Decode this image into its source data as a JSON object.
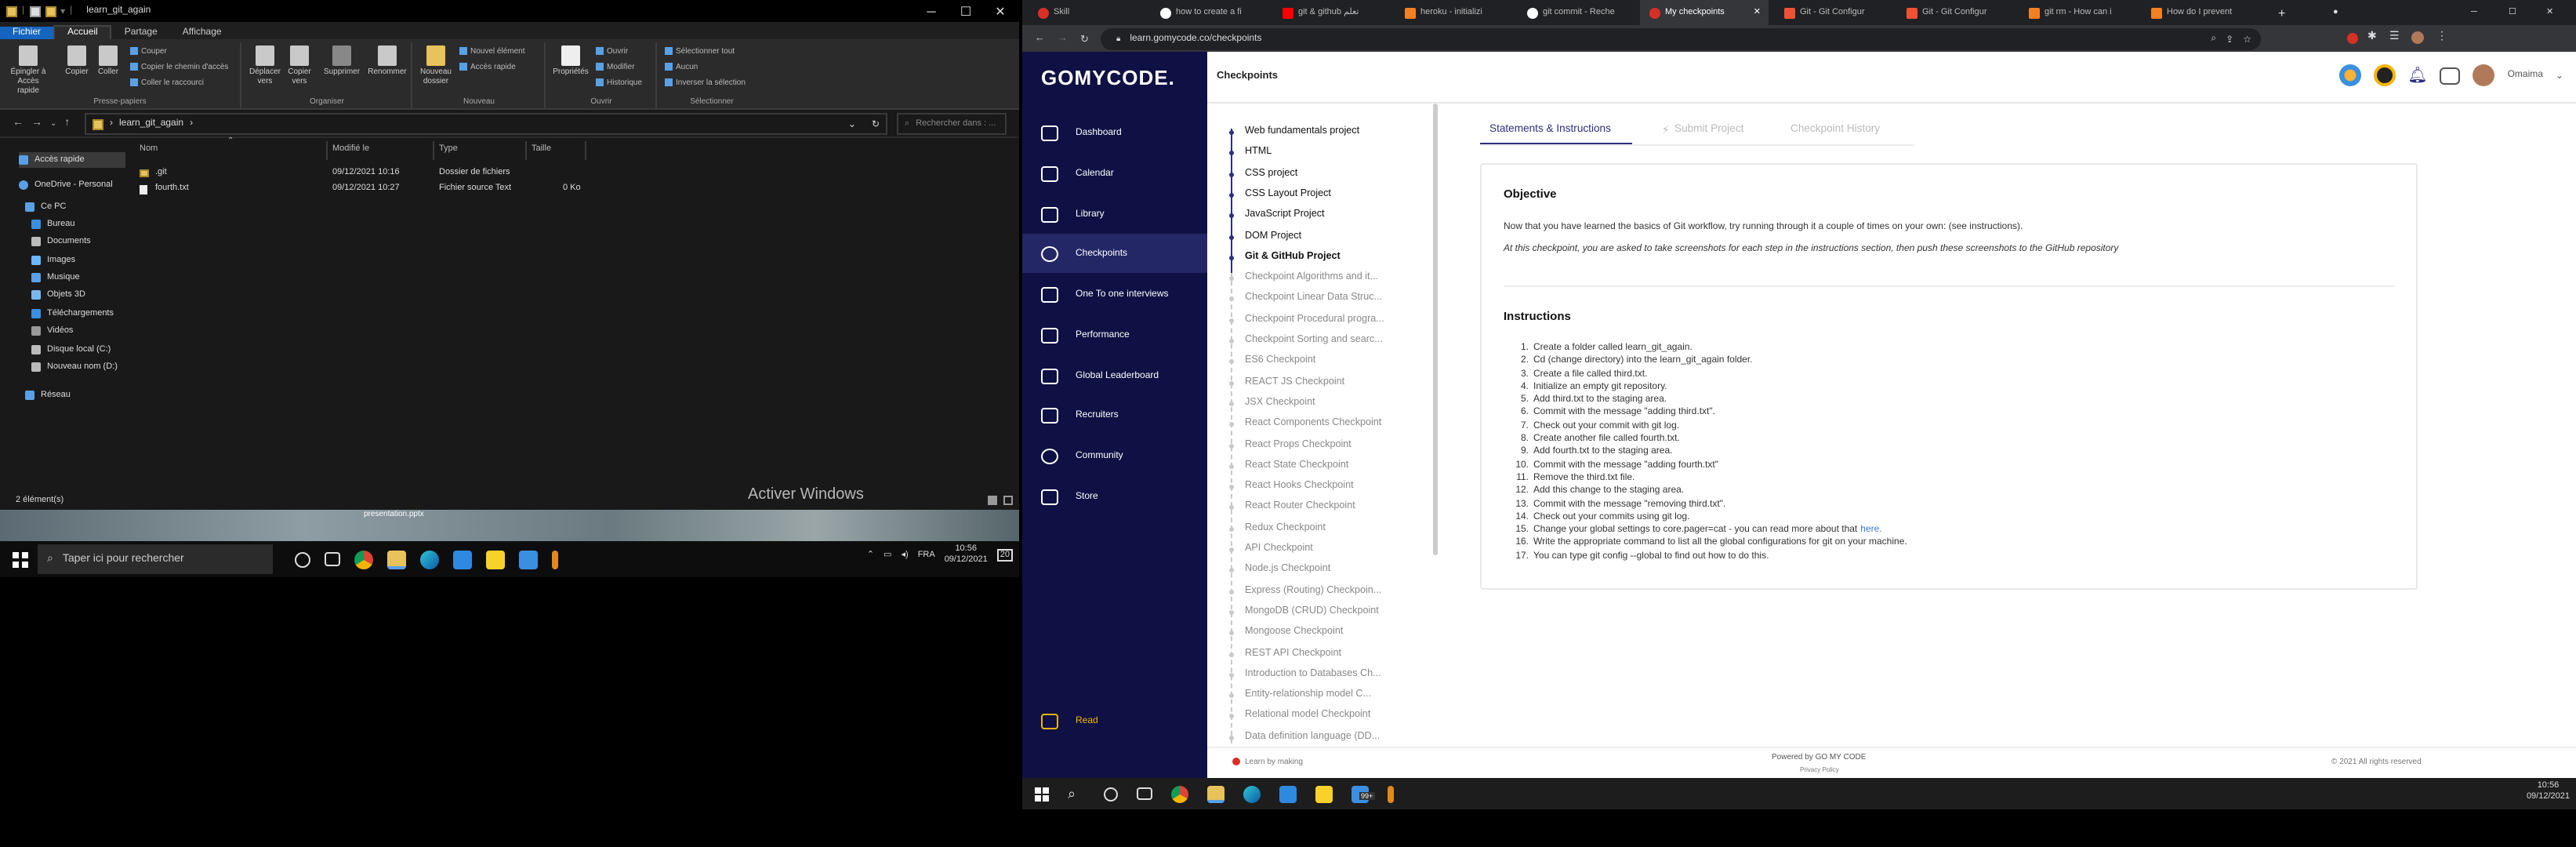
{
  "explorer": {
    "title": "learn_git_again",
    "menu_tabs": [
      "Fichier",
      "Accueil",
      "Partage",
      "Affichage"
    ],
    "ribbon": {
      "pin": "Épingler à\nAccès rapide",
      "copy": "Copier",
      "paste": "Coller",
      "cut": "Couper",
      "copy_path": "Copier le chemin d'accès",
      "paste_shortcut": "Coller le raccourci",
      "group_clipboard": "Presse-papiers",
      "move_to": "Déplacer\nvers",
      "copy_to": "Copier\nvers",
      "delete": "Supprimer",
      "rename": "Renommer",
      "group_organize": "Organiser",
      "new_folder": "Nouveau\ndossier",
      "new_item": "Nouvel élément",
      "easy_access": "Accès rapide",
      "group_new": "Nouveau",
      "properties": "Propriétés",
      "open": "Ouvrir",
      "edit": "Modifier",
      "history": "Historique",
      "group_open": "Ouvrir",
      "select_all": "Sélectionner tout",
      "select_none": "Aucun",
      "invert_selection": "Inverser la sélection",
      "group_select": "Sélectionner"
    },
    "address_path": "learn_git_again",
    "search_placeholder": "Rechercher dans : ...",
    "nav": [
      "Accès rapide",
      "OneDrive - Personal",
      "Ce PC",
      "Bureau",
      "Documents",
      "Images",
      "Musique",
      "Objets 3D",
      "Téléchargements",
      "Vidéos",
      "Disque local (C:)",
      "Nouveau nom (D:)",
      "Réseau"
    ],
    "columns": [
      "Nom",
      "Modifié le",
      "Type",
      "Taille"
    ],
    "files": [
      {
        "name": ".git",
        "modified": "09/12/2021 10:16",
        "type": "Dossier de fichiers",
        "size": ""
      },
      {
        "name": "fourth.txt",
        "modified": "09/12/2021 10:27",
        "type": "Fichier source Text",
        "size": "0 Ko"
      }
    ],
    "status": "2 élément(s)"
  },
  "desktop": {
    "activate_windows": "Activer Windows",
    "presentation_label": "presentation.pptx"
  },
  "left_taskbar": {
    "search_placeholder": "Taper ici pour rechercher",
    "lang": "FRA",
    "time": "10:56",
    "date": "09/12/2021",
    "notif_count": "20"
  },
  "browser": {
    "tabs": [
      "Skill",
      "how to create a fi",
      "git & github تعلم",
      "heroku - initializi",
      "git commit - Reche",
      "My checkpoints",
      "Git - Git Configur",
      "Git - Git Configur",
      "git rm - How can i",
      "How do I prevent"
    ],
    "active_tab_index": 5,
    "url": "learn.gomycode.co/checkpoints"
  },
  "site": {
    "logo": "GOMYCODE.",
    "page_title": "Checkpoints",
    "user_name": "Omaima",
    "sidebar": [
      "Dashboard",
      "Calendar",
      "Library",
      "Checkpoints",
      "One To one interviews",
      "Performance",
      "Global Leaderboard",
      "Recruiters",
      "Community",
      "Store"
    ],
    "sidebar_active": "Checkpoints",
    "sidebar_bottom": "Read",
    "checkpoints_done": [
      "Web fundamentals project",
      "HTML",
      "CSS project",
      "CSS Layout Project",
      "JavaScript Project",
      "DOM Project",
      "Git & GitHub Project"
    ],
    "checkpoints_pending": [
      "Checkpoint Algorithms and it...",
      "Checkpoint Linear Data Struc...",
      "Checkpoint Procedural progra...",
      "Checkpoint Sorting and searc...",
      "ES6 Checkpoint",
      "REACT JS Checkpoint",
      "JSX Checkpoint",
      "React Components Checkpoint",
      "React Props Checkpoint",
      "React State Checkpoint",
      "React Hooks Checkpoint",
      "React Router Checkpoint",
      "Redux Checkpoint",
      "API Checkpoint",
      "Node.js Checkpoint",
      "Express (Routing) Checkpoin...",
      "MongoDB (CRUD) Checkpoint",
      "Mongoose Checkpoint",
      "REST API Checkpoint",
      "Introduction to Databases Ch...",
      "Entity-relationship model C...",
      "Relational model Checkpoint",
      "Data definition language (DD..."
    ],
    "content_tabs": [
      "Statements & Instructions",
      "Submit Project",
      "Checkpoint History"
    ],
    "objective_title": "Objective",
    "objective_text": "Now that you have learned the basics of Git workflow, try running through it a couple of times on your own: (see instructions).",
    "objective_note": "At this checkpoint, you are asked to take screenshots for each step in the instructions section, then push these screenshots to the GitHub repository",
    "instructions_title": "Instructions",
    "instructions": [
      "Create a folder called learn_git_again.",
      "Cd (change directory) into the learn_git_again folder.",
      "Create a file called third.txt.",
      "Initialize an empty git repository.",
      "Add third.txt to the staging area.",
      "Commit with the message \"adding third.txt\".",
      "Check out your commit with git log.",
      "Create another file called fourth.txt.",
      "Add fourth.txt to the staging area.",
      "Commit with the message \"adding fourth.txt\"",
      "Remove the third.txt file.",
      "Add this change to the staging area.",
      "Commit with the message \"removing third.txt\".",
      "Check out your commits using git log.",
      "Change your global settings to core.pager=cat - you can read more about that",
      "Write the appropriate  command to list all the global configurations for git on your machine.",
      "You can type git config --global to find out how to do this."
    ],
    "instructions_link": "here.",
    "footer_left": "Learn by making",
    "footer_center": "Powered by GO MY CODE",
    "footer_privacy": "Privacy Policy",
    "footer_right": "© 2021 All rights reserved"
  },
  "right_taskbar": {
    "time": "10:56",
    "date": "09/12/2021",
    "badge": "99+"
  },
  "colors": {
    "navy": "#0f1144",
    "accent": "#2c2f80",
    "explorer_bg": "#191919"
  }
}
